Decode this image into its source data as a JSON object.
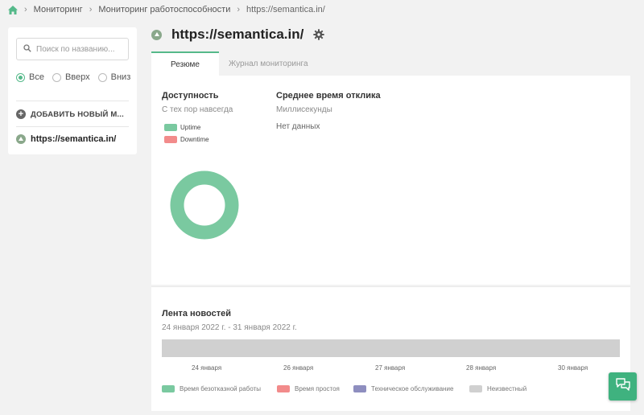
{
  "breadcrumb": {
    "items": [
      "Мониторинг",
      "Мониторинг работоспособности",
      "https://semantica.in/"
    ]
  },
  "sidebar": {
    "search_placeholder": "Поиск по названию...",
    "filters": [
      {
        "label": "Все",
        "checked": true
      },
      {
        "label": "Вверх",
        "checked": false
      },
      {
        "label": "Вниз",
        "checked": false
      }
    ],
    "add_label": "ДОБАВИТЬ НОВЫЙ М...",
    "monitors": [
      {
        "name": "https://semantica.in/",
        "status": "up"
      }
    ]
  },
  "header": {
    "title": "https://semantica.in/"
  },
  "tabs": [
    {
      "label": "Резюме",
      "active": true
    },
    {
      "label": "Журнал мониторинга",
      "active": false
    }
  ],
  "availability": {
    "title": "Доступность",
    "subtitle": "С тех пор навсегда",
    "legend": [
      {
        "label": "Uptime",
        "color": "#7ac9a0"
      },
      {
        "label": "Downtime",
        "color": "#f28b8b"
      }
    ]
  },
  "response_time": {
    "title": "Среднее время отклика",
    "subtitle": "Миллисекунды",
    "empty": "Нет данных"
  },
  "news": {
    "title": "Лента новостей",
    "range": "24 января 2022 г. - 31 января 2022 г.",
    "ticks": [
      "24 января",
      "26 января",
      "27 января",
      "28 января",
      "30 января"
    ],
    "legend": [
      {
        "label": "Время безотказной работы",
        "color": "#7ac9a0"
      },
      {
        "label": "Время простоя",
        "color": "#f28b8b"
      },
      {
        "label": "Техническое обслуживание",
        "color": "#8e8ebf"
      },
      {
        "label": "Неизвестный",
        "color": "#d0d0d0"
      }
    ]
  },
  "chart_data": {
    "type": "pie",
    "categories": [
      "Uptime",
      "Downtime"
    ],
    "values": [
      100,
      0
    ]
  },
  "colors": {
    "accent": "#55b98a",
    "chat_button": "#3fb27f"
  }
}
